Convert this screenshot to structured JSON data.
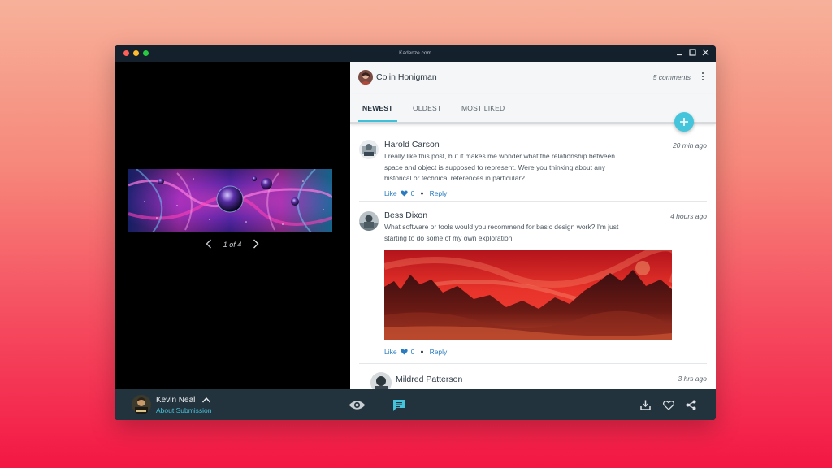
{
  "window": {
    "title": "Kadenze.com"
  },
  "viewer": {
    "pager_text": "1 of 4"
  },
  "header": {
    "author": "Colin Honigman",
    "comment_count": "5 comments"
  },
  "tabs": [
    {
      "label": "NEWEST",
      "active": true
    },
    {
      "label": "OLDEST",
      "active": false
    },
    {
      "label": "MOST LIKED",
      "active": false
    }
  ],
  "comments": [
    {
      "name": "Harold Carson",
      "time": "20 min ago",
      "text": "I really like this post, but it makes me wonder what the relationship between space and object is supposed to represent. Were you thinking about any historical or technical references in particular?",
      "like_label": "Like",
      "likes": "0",
      "reply_label": "Reply"
    },
    {
      "name": "Bess Dixon",
      "time": "4 hours ago",
      "text": "What software or tools would you recommend for basic design work? I'm just starting to do some of my own exploration.",
      "like_label": "Like",
      "likes": "0",
      "reply_label": "Reply"
    },
    {
      "name": "Mildred Patterson",
      "time": "3 hrs ago"
    }
  ],
  "footer": {
    "user_name": "Kevin Neal",
    "user_sub": "About Submission"
  },
  "colors": {
    "accent": "#45c5dc",
    "link": "#2a7bbf",
    "titlebar": "#14212d",
    "bottombar": "#23333e"
  },
  "icons": [
    "close-icon",
    "maximize-icon",
    "minimize-icon",
    "chevron-left-icon",
    "chevron-right-icon",
    "more-vertical-icon",
    "plus-icon",
    "heart-icon",
    "chevron-up-icon",
    "eye-icon",
    "comment-icon",
    "download-icon",
    "share-icon"
  ]
}
